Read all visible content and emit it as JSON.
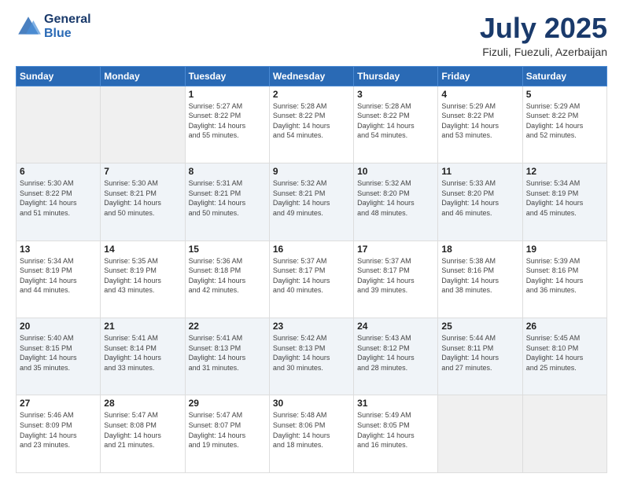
{
  "header": {
    "logo_line1": "General",
    "logo_line2": "Blue",
    "month": "July 2025",
    "location": "Fizuli, Fuezuli, Azerbaijan"
  },
  "days_of_week": [
    "Sunday",
    "Monday",
    "Tuesday",
    "Wednesday",
    "Thursday",
    "Friday",
    "Saturday"
  ],
  "weeks": [
    [
      {
        "num": "",
        "info": ""
      },
      {
        "num": "",
        "info": ""
      },
      {
        "num": "1",
        "info": "Sunrise: 5:27 AM\nSunset: 8:22 PM\nDaylight: 14 hours\nand 55 minutes."
      },
      {
        "num": "2",
        "info": "Sunrise: 5:28 AM\nSunset: 8:22 PM\nDaylight: 14 hours\nand 54 minutes."
      },
      {
        "num": "3",
        "info": "Sunrise: 5:28 AM\nSunset: 8:22 PM\nDaylight: 14 hours\nand 54 minutes."
      },
      {
        "num": "4",
        "info": "Sunrise: 5:29 AM\nSunset: 8:22 PM\nDaylight: 14 hours\nand 53 minutes."
      },
      {
        "num": "5",
        "info": "Sunrise: 5:29 AM\nSunset: 8:22 PM\nDaylight: 14 hours\nand 52 minutes."
      }
    ],
    [
      {
        "num": "6",
        "info": "Sunrise: 5:30 AM\nSunset: 8:22 PM\nDaylight: 14 hours\nand 51 minutes."
      },
      {
        "num": "7",
        "info": "Sunrise: 5:30 AM\nSunset: 8:21 PM\nDaylight: 14 hours\nand 50 minutes."
      },
      {
        "num": "8",
        "info": "Sunrise: 5:31 AM\nSunset: 8:21 PM\nDaylight: 14 hours\nand 50 minutes."
      },
      {
        "num": "9",
        "info": "Sunrise: 5:32 AM\nSunset: 8:21 PM\nDaylight: 14 hours\nand 49 minutes."
      },
      {
        "num": "10",
        "info": "Sunrise: 5:32 AM\nSunset: 8:20 PM\nDaylight: 14 hours\nand 48 minutes."
      },
      {
        "num": "11",
        "info": "Sunrise: 5:33 AM\nSunset: 8:20 PM\nDaylight: 14 hours\nand 46 minutes."
      },
      {
        "num": "12",
        "info": "Sunrise: 5:34 AM\nSunset: 8:19 PM\nDaylight: 14 hours\nand 45 minutes."
      }
    ],
    [
      {
        "num": "13",
        "info": "Sunrise: 5:34 AM\nSunset: 8:19 PM\nDaylight: 14 hours\nand 44 minutes."
      },
      {
        "num": "14",
        "info": "Sunrise: 5:35 AM\nSunset: 8:19 PM\nDaylight: 14 hours\nand 43 minutes."
      },
      {
        "num": "15",
        "info": "Sunrise: 5:36 AM\nSunset: 8:18 PM\nDaylight: 14 hours\nand 42 minutes."
      },
      {
        "num": "16",
        "info": "Sunrise: 5:37 AM\nSunset: 8:17 PM\nDaylight: 14 hours\nand 40 minutes."
      },
      {
        "num": "17",
        "info": "Sunrise: 5:37 AM\nSunset: 8:17 PM\nDaylight: 14 hours\nand 39 minutes."
      },
      {
        "num": "18",
        "info": "Sunrise: 5:38 AM\nSunset: 8:16 PM\nDaylight: 14 hours\nand 38 minutes."
      },
      {
        "num": "19",
        "info": "Sunrise: 5:39 AM\nSunset: 8:16 PM\nDaylight: 14 hours\nand 36 minutes."
      }
    ],
    [
      {
        "num": "20",
        "info": "Sunrise: 5:40 AM\nSunset: 8:15 PM\nDaylight: 14 hours\nand 35 minutes."
      },
      {
        "num": "21",
        "info": "Sunrise: 5:41 AM\nSunset: 8:14 PM\nDaylight: 14 hours\nand 33 minutes."
      },
      {
        "num": "22",
        "info": "Sunrise: 5:41 AM\nSunset: 8:13 PM\nDaylight: 14 hours\nand 31 minutes."
      },
      {
        "num": "23",
        "info": "Sunrise: 5:42 AM\nSunset: 8:13 PM\nDaylight: 14 hours\nand 30 minutes."
      },
      {
        "num": "24",
        "info": "Sunrise: 5:43 AM\nSunset: 8:12 PM\nDaylight: 14 hours\nand 28 minutes."
      },
      {
        "num": "25",
        "info": "Sunrise: 5:44 AM\nSunset: 8:11 PM\nDaylight: 14 hours\nand 27 minutes."
      },
      {
        "num": "26",
        "info": "Sunrise: 5:45 AM\nSunset: 8:10 PM\nDaylight: 14 hours\nand 25 minutes."
      }
    ],
    [
      {
        "num": "27",
        "info": "Sunrise: 5:46 AM\nSunset: 8:09 PM\nDaylight: 14 hours\nand 23 minutes."
      },
      {
        "num": "28",
        "info": "Sunrise: 5:47 AM\nSunset: 8:08 PM\nDaylight: 14 hours\nand 21 minutes."
      },
      {
        "num": "29",
        "info": "Sunrise: 5:47 AM\nSunset: 8:07 PM\nDaylight: 14 hours\nand 19 minutes."
      },
      {
        "num": "30",
        "info": "Sunrise: 5:48 AM\nSunset: 8:06 PM\nDaylight: 14 hours\nand 18 minutes."
      },
      {
        "num": "31",
        "info": "Sunrise: 5:49 AM\nSunset: 8:05 PM\nDaylight: 14 hours\nand 16 minutes."
      },
      {
        "num": "",
        "info": ""
      },
      {
        "num": "",
        "info": ""
      }
    ]
  ]
}
